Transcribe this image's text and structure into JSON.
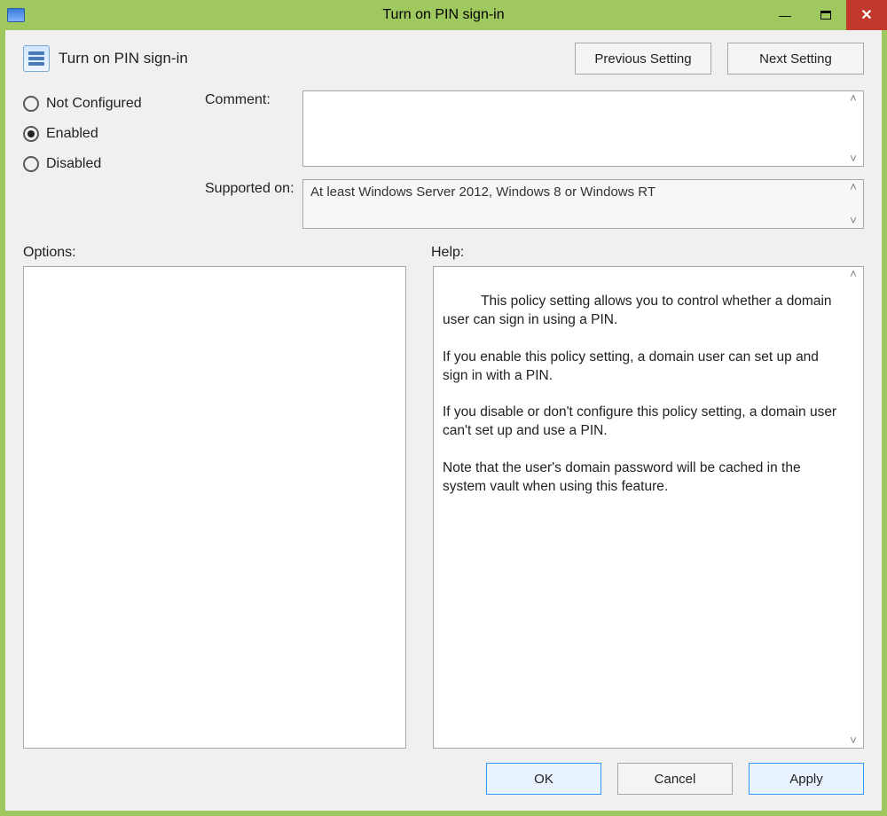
{
  "window": {
    "title": "Turn on PIN sign-in"
  },
  "header": {
    "setting_title": "Turn on PIN sign-in",
    "previous_label": "Previous Setting",
    "next_label": "Next Setting"
  },
  "state": {
    "options": {
      "not_configured": "Not Configured",
      "enabled": "Enabled",
      "disabled": "Disabled"
    },
    "selected": "enabled"
  },
  "fields": {
    "comment_label": "Comment:",
    "comment_value": "",
    "supported_label": "Supported on:",
    "supported_value": "At least Windows Server 2012, Windows 8 or Windows RT"
  },
  "panels": {
    "options_header": "Options:",
    "help_header": "Help:",
    "help_text": "This policy setting allows you to control whether a domain user can sign in using a PIN.\n\nIf you enable this policy setting, a domain user can set up and sign in with a PIN.\n\nIf you disable or don't configure this policy setting, a domain user can't set up and use a PIN.\n\nNote that the user's domain password will be cached in the system vault when using this feature."
  },
  "footer": {
    "ok": "OK",
    "cancel": "Cancel",
    "apply": "Apply"
  },
  "glyphs": {
    "minimize": "—",
    "close": "✕",
    "up": "˄",
    "down": "˅"
  }
}
